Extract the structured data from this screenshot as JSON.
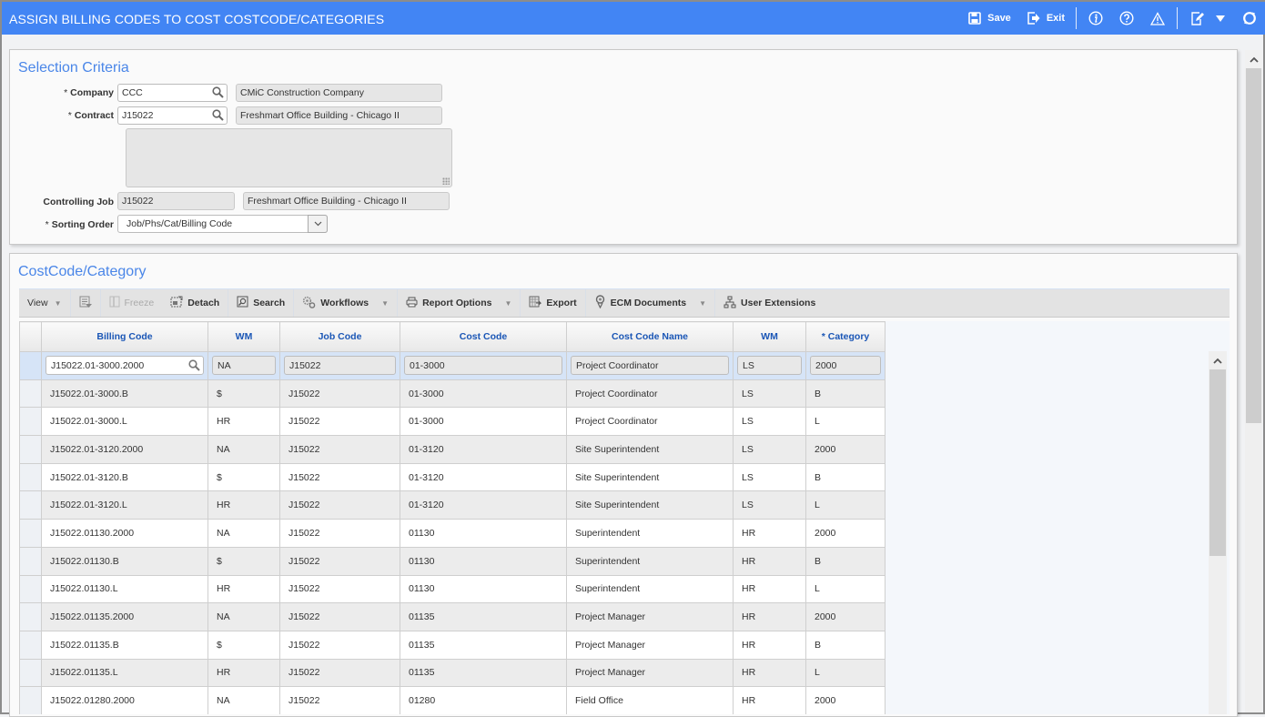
{
  "header": {
    "title": "ASSIGN BILLING CODES TO COST COSTCODE/CATEGORIES",
    "save_label": "Save",
    "exit_label": "Exit",
    "accent_color": "#4285f4"
  },
  "selection": {
    "title": "Selection Criteria",
    "company": {
      "label": "Company",
      "required": "*",
      "value": "CCC",
      "description": "CMiC Construction Company"
    },
    "contract": {
      "label": "Contract",
      "required": "*",
      "value": "J15022",
      "description": "Freshmart Office Building - Chicago II"
    },
    "notes": "",
    "controlling_job": {
      "label": "Controlling Job",
      "value": "J15022",
      "description": "Freshmart Office Building - Chicago II"
    },
    "sorting_order": {
      "label": "Sorting Order",
      "required": "*",
      "value": "Job/Phs/Cat/Billing Code"
    }
  },
  "costcode": {
    "title": "CostCode/Category",
    "toolbar": {
      "view": "View",
      "freeze": "Freeze",
      "detach": "Detach",
      "search": "Search",
      "workflows": "Workflows",
      "report_options": "Report Options",
      "export": "Export",
      "ecm_documents": "ECM Documents",
      "user_extensions": "User Extensions"
    },
    "columns": [
      "Billing Code",
      "WM",
      "Job Code",
      "Cost Code",
      "Cost Code Name",
      "WM",
      "* Category"
    ],
    "selected_row": [
      "J15022.01-3000.2000",
      "NA",
      "J15022",
      "01-3000",
      "Project Coordinator",
      "LS",
      "2000"
    ],
    "rows": [
      [
        "J15022.01-3000.B",
        "$",
        "J15022",
        "01-3000",
        "Project Coordinator",
        "LS",
        "B"
      ],
      [
        "J15022.01-3000.L",
        "HR",
        "J15022",
        "01-3000",
        "Project Coordinator",
        "LS",
        "L"
      ],
      [
        "J15022.01-3120.2000",
        "NA",
        "J15022",
        "01-3120",
        "Site Superintendent",
        "LS",
        "2000"
      ],
      [
        "J15022.01-3120.B",
        "$",
        "J15022",
        "01-3120",
        "Site Superintendent",
        "LS",
        "B"
      ],
      [
        "J15022.01-3120.L",
        "HR",
        "J15022",
        "01-3120",
        "Site Superintendent",
        "LS",
        "L"
      ],
      [
        "J15022.01130.2000",
        "NA",
        "J15022",
        "01130",
        "Superintendent",
        "HR",
        "2000"
      ],
      [
        "J15022.01130.B",
        "$",
        "J15022",
        "01130",
        "Superintendent",
        "HR",
        "B"
      ],
      [
        "J15022.01130.L",
        "HR",
        "J15022",
        "01130",
        "Superintendent",
        "HR",
        "L"
      ],
      [
        "J15022.01135.2000",
        "NA",
        "J15022",
        "01135",
        "Project Manager",
        "HR",
        "2000"
      ],
      [
        "J15022.01135.B",
        "$",
        "J15022",
        "01135",
        "Project Manager",
        "HR",
        "B"
      ],
      [
        "J15022.01135.L",
        "HR",
        "J15022",
        "01135",
        "Project Manager",
        "HR",
        "L"
      ],
      [
        "J15022.01280.2000",
        "NA",
        "J15022",
        "01280",
        "Field Office",
        "HR",
        "2000"
      ]
    ]
  }
}
